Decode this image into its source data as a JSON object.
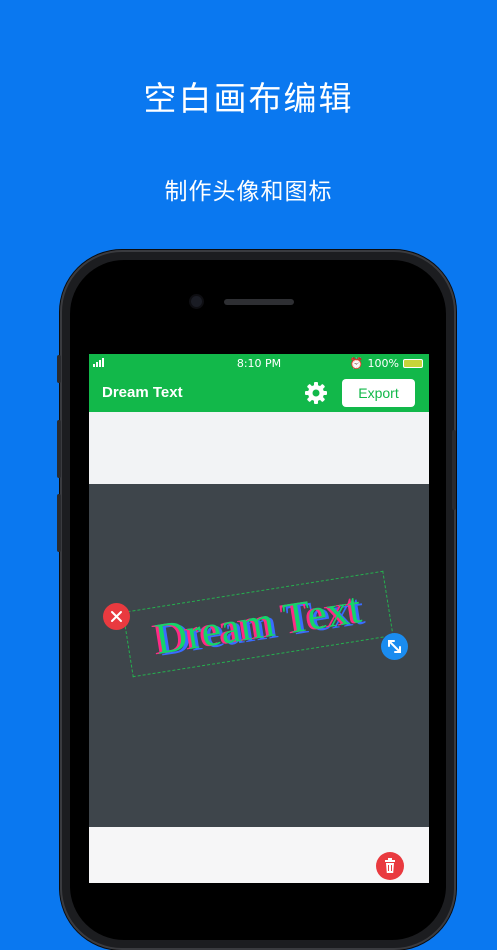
{
  "promo": {
    "headline": "空白画布编辑",
    "subheadline": "制作头像和图标"
  },
  "status_bar": {
    "time": "8:10 PM",
    "battery": "100%"
  },
  "app_bar": {
    "title": "Dream Text",
    "export_label": "Export"
  },
  "canvas": {
    "text": "Dream Text"
  },
  "icons": {
    "settings": "gear-icon",
    "close": "close-icon",
    "resize": "resize-icon",
    "delete": "trash-icon"
  },
  "colors": {
    "background": "#0a78f0",
    "app_green": "#12b84a",
    "canvas": "#3e454b",
    "danger": "#e93a3f",
    "accent_blue": "#1a8cf0"
  }
}
